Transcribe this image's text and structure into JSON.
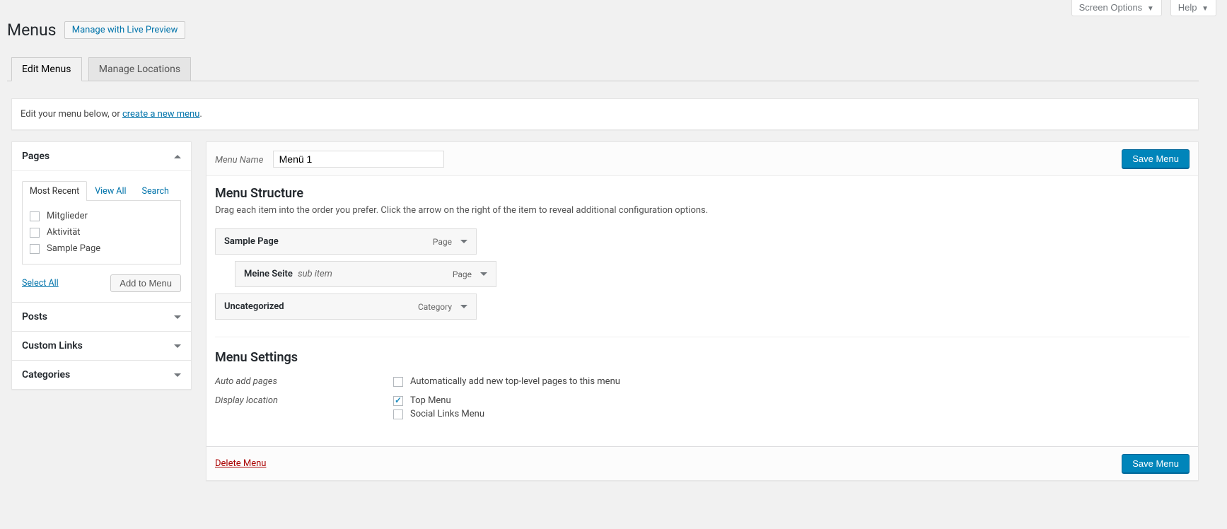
{
  "top_options": {
    "screen_options_label": "Screen Options",
    "help_label": "Help"
  },
  "page": {
    "title": "Menus",
    "live_preview_button": "Manage with Live Preview"
  },
  "nav_tabs": {
    "edit": "Edit Menus",
    "locations": "Manage Locations"
  },
  "notice": {
    "prefix": "Edit your menu below, or ",
    "link": "create a new menu"
  },
  "sidebar": {
    "pages": {
      "title": "Pages",
      "inner_tabs": {
        "recent": "Most Recent",
        "viewall": "View All",
        "search": "Search"
      },
      "items": [
        {
          "label": "Mitglieder"
        },
        {
          "label": "Aktivität"
        },
        {
          "label": "Sample Page"
        }
      ],
      "select_all": "Select All",
      "add_button": "Add to Menu"
    },
    "posts_title": "Posts",
    "custom_links_title": "Custom Links",
    "categories_title": "Categories"
  },
  "menu": {
    "name_label": "Menu Name",
    "name_value": "Menü 1",
    "save_button": "Save Menu",
    "structure": {
      "title": "Menu Structure",
      "desc": "Drag each item into the order you prefer. Click the arrow on the right of the item to reveal additional configuration options.",
      "items": [
        {
          "title": "Sample Page",
          "type": "Page",
          "sub": false,
          "indent": false
        },
        {
          "title": "Meine Seite",
          "type": "Page",
          "sub": true,
          "indent": true,
          "sub_label": "sub item"
        },
        {
          "title": "Uncategorized",
          "type": "Category",
          "sub": false,
          "indent": false
        }
      ]
    },
    "settings": {
      "title": "Menu Settings",
      "auto_add_label": "Auto add pages",
      "auto_add_option": "Automatically add new top-level pages to this menu",
      "display_location_label": "Display location",
      "locations": [
        {
          "label": "Top Menu",
          "checked": true
        },
        {
          "label": "Social Links Menu",
          "checked": false
        }
      ]
    },
    "delete_label": "Delete Menu"
  }
}
